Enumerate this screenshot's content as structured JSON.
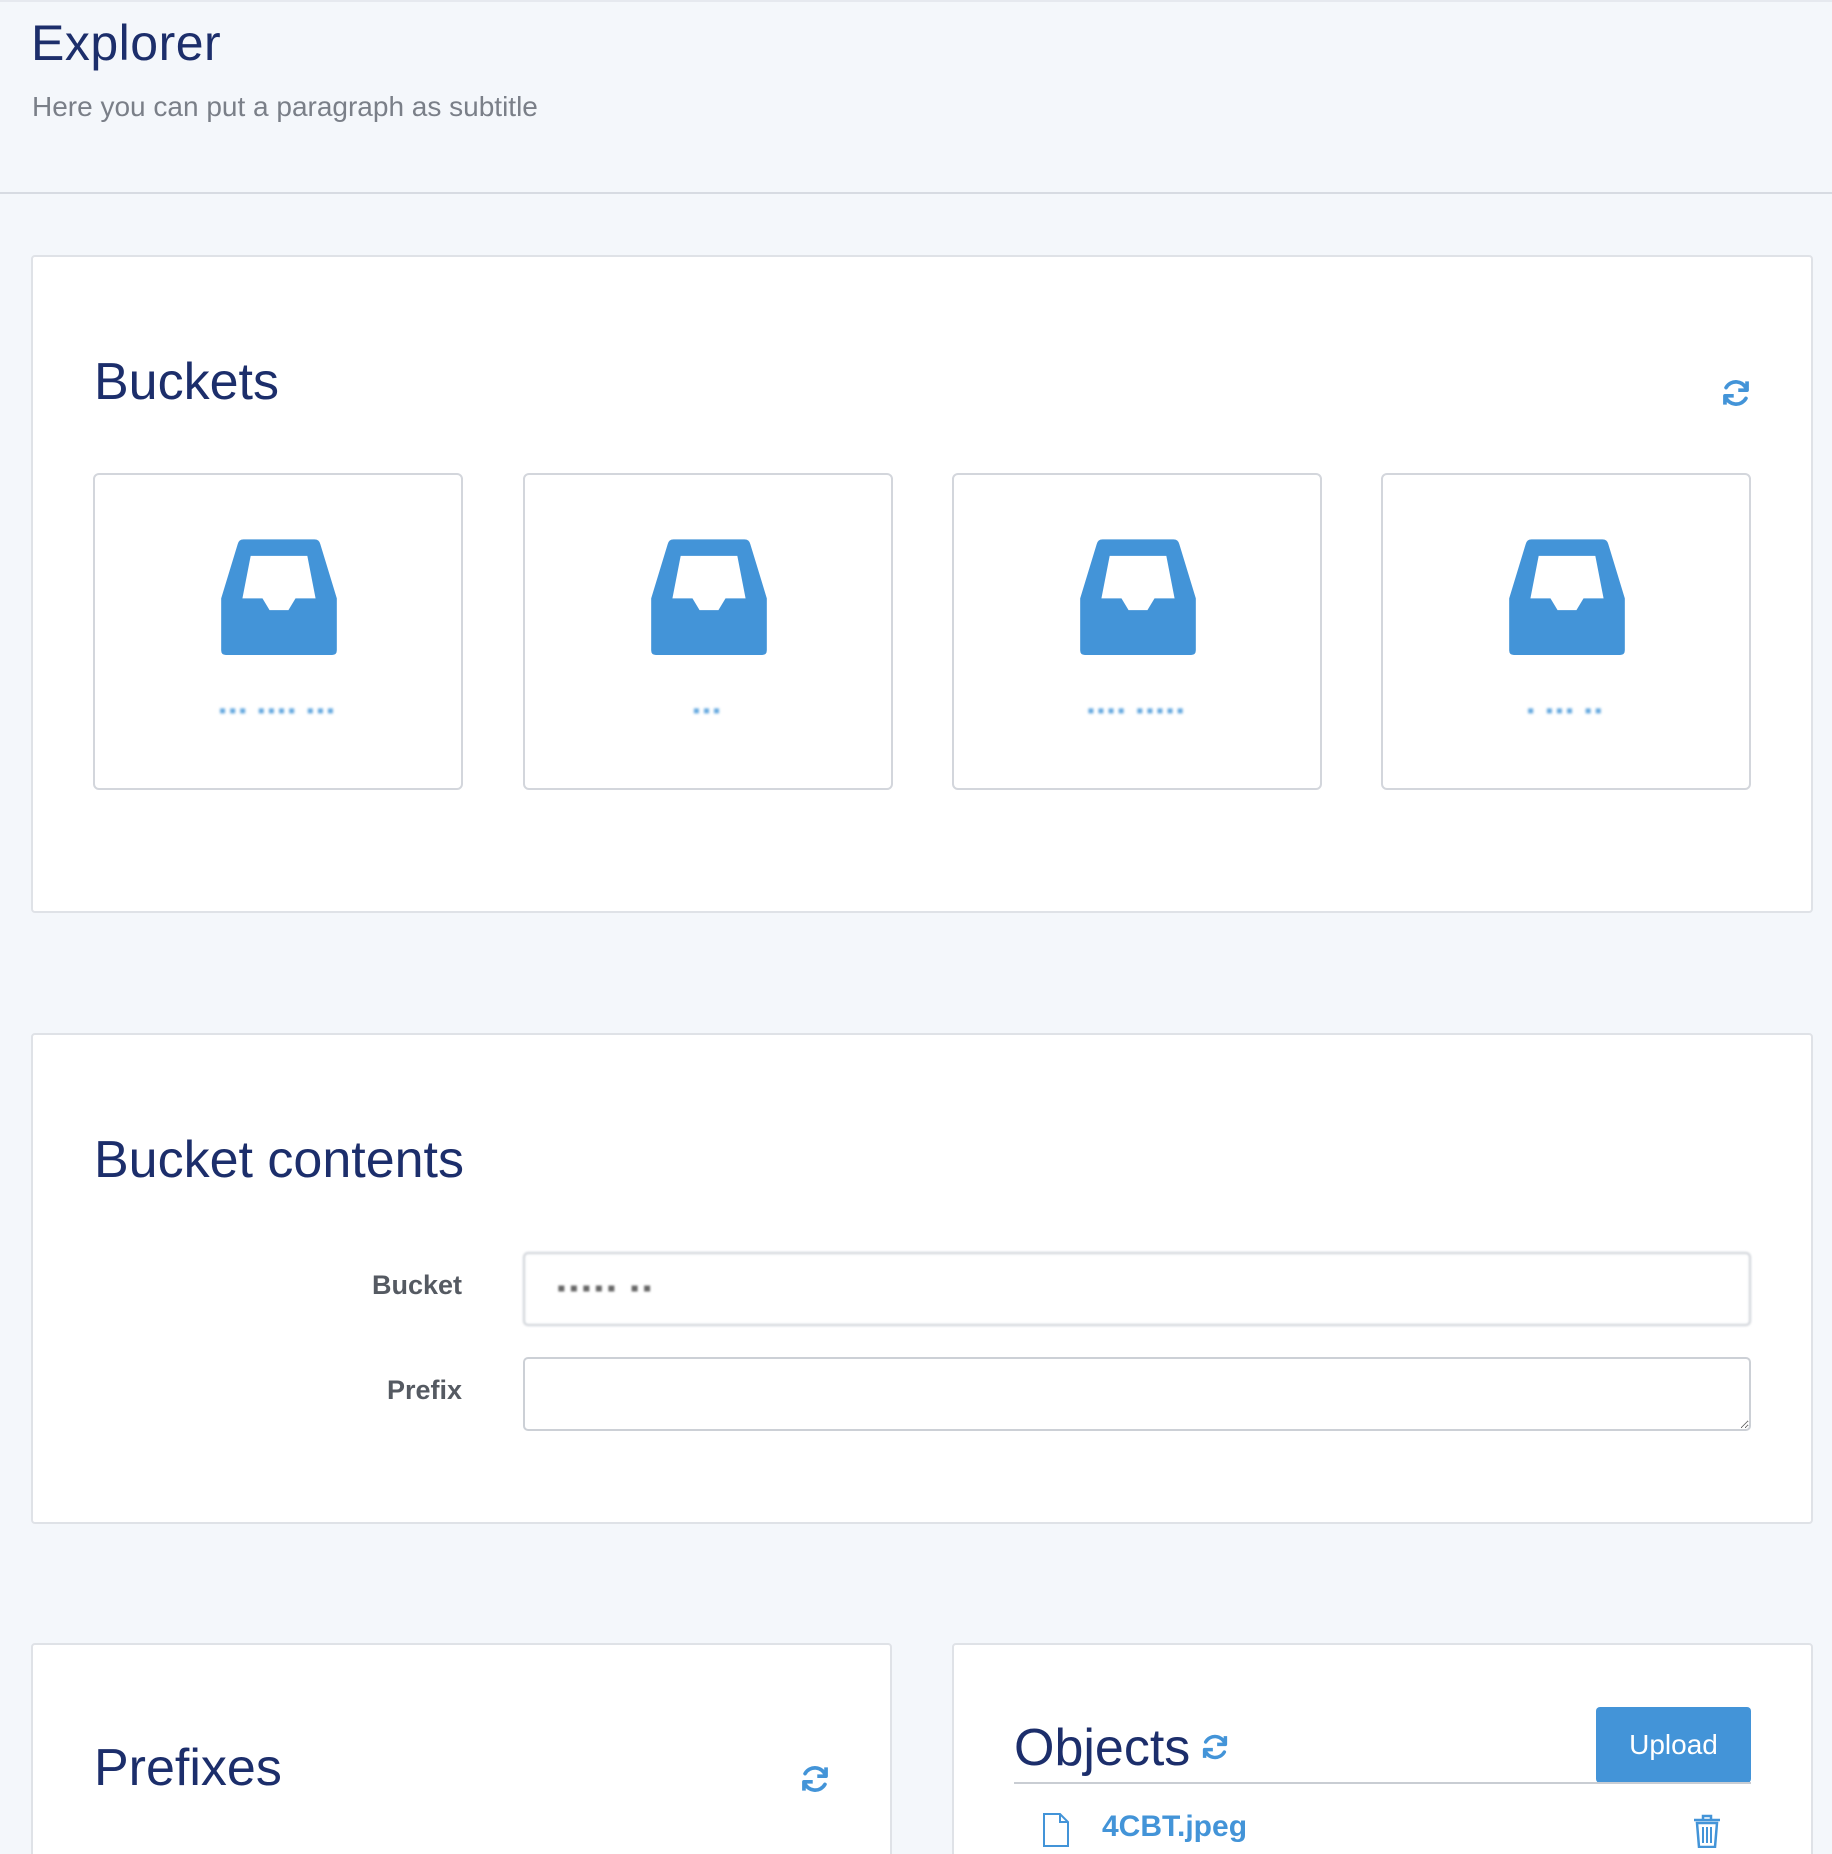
{
  "header": {
    "title": "Explorer",
    "subtitle": "Here you can put a paragraph as subtitle"
  },
  "buckets": {
    "title": "Buckets",
    "refresh_icon": "refresh-icon",
    "items": [
      {
        "name": "▪▪▪ ▪▪▪▪ ▪▪▪",
        "icon": "inbox-icon"
      },
      {
        "name": "▪▪▪",
        "icon": "inbox-icon"
      },
      {
        "name": "▪▪▪▪ ▪▪▪▪▪",
        "icon": "inbox-icon"
      },
      {
        "name": "▪ ▪▪▪ ▪▪",
        "icon": "inbox-icon"
      }
    ]
  },
  "bucket_contents": {
    "title": "Bucket contents",
    "bucket_label": "Bucket",
    "bucket_value": "▪▪▪▪▪ ▪▪",
    "prefix_label": "Prefix",
    "prefix_value": ""
  },
  "prefixes": {
    "title": "Prefixes",
    "refresh_icon": "refresh-icon"
  },
  "objects": {
    "title": "Objects",
    "refresh_icon": "refresh-icon",
    "upload_label": "Upload",
    "rows": [
      {
        "name": "4CBT.jpeg",
        "icon": "file-icon",
        "action_icon": "trash-icon"
      }
    ]
  },
  "colors": {
    "accent": "#4394d8",
    "title_navy": "#1c2e6b",
    "background": "#f4f7fb"
  }
}
